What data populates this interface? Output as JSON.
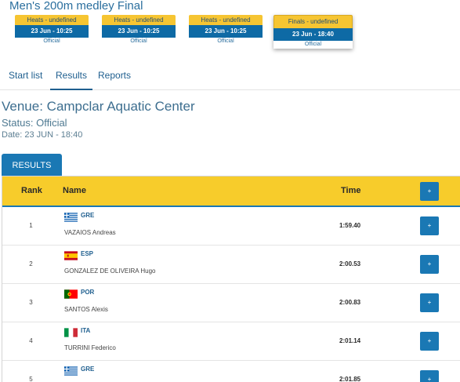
{
  "event_title": "Men's 200m medley Final",
  "phases": [
    {
      "name": "Heats - undefined",
      "datetime": "23 Jun - 10:25",
      "status": "Official",
      "active": false
    },
    {
      "name": "Heats - undefined",
      "datetime": "23 Jun - 10:25",
      "status": "Official",
      "active": false
    },
    {
      "name": "Heats - undefined",
      "datetime": "23 Jun - 10:25",
      "status": "Official",
      "active": false
    },
    {
      "name": "Finals - undefined",
      "datetime": "23 Jun - 18:40",
      "status": "Official",
      "active": true
    }
  ],
  "tabs": [
    {
      "label": "Start list",
      "active": false
    },
    {
      "label": "Results",
      "active": true
    },
    {
      "label": "Reports",
      "active": false
    }
  ],
  "venue": "Venue: Campclar Aquatic Center",
  "status": "Status: Official",
  "date": "Date: 23 JUN - 18:40",
  "results_tab_label": "RESULTS",
  "table": {
    "headers": {
      "rank": "Rank",
      "name": "Name",
      "time": "Time"
    },
    "expand_icon": "+",
    "rows": [
      {
        "rank": "1",
        "noc": "GRE",
        "flag": "greece-flag",
        "athlete": "VAZAIOS Andreas",
        "time": "1:59.40"
      },
      {
        "rank": "2",
        "noc": "ESP",
        "flag": "spain-flag",
        "athlete": "GONZALEZ DE OLIVEIRA Hugo",
        "time": "2:00.53"
      },
      {
        "rank": "3",
        "noc": "POR",
        "flag": "portugal-flag",
        "athlete": "SANTOS Alexis",
        "time": "2:00.83"
      },
      {
        "rank": "4",
        "noc": "ITA",
        "flag": "italy-flag",
        "athlete": "TURRINI Federico",
        "time": "2:01.14"
      },
      {
        "rank": "5",
        "noc": "GRE",
        "flag": "greece-flag",
        "athlete": "",
        "time": "2:01.85"
      }
    ]
  },
  "colors": {
    "accent_blue": "#1a78b4",
    "header_yellow": "#f7cc2b",
    "title_blue": "#2b6f9e"
  }
}
